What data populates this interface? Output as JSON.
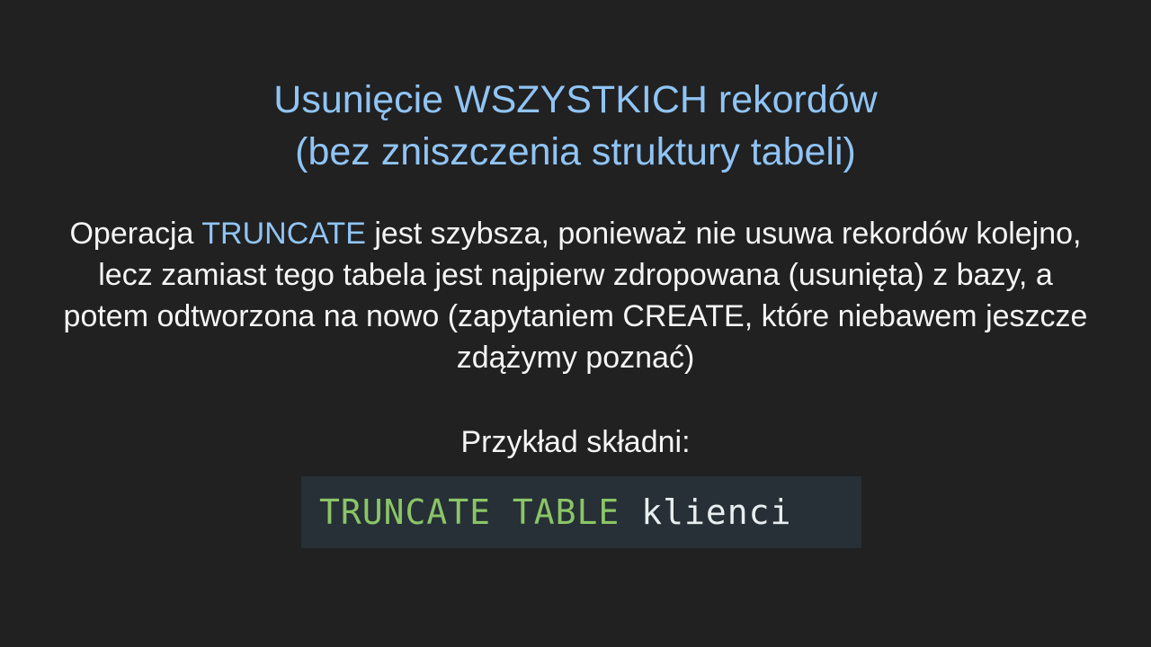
{
  "title": {
    "line1": "Usunięcie WSZYSTKICH rekordów",
    "line2": "(bez zniszczenia struktury tabeli)"
  },
  "body": {
    "prefix": "Operacja ",
    "highlight": "TRUNCATE",
    "rest": " jest szybsza, ponieważ nie usuwa rekordów kolejno, lecz zamiast tego tabela jest najpierw zdropowana (usunięta) z bazy, a potem odtworzona na nowo (zapytaniem CREATE, które niebawem jeszcze zdążymy poznać)"
  },
  "example": {
    "label": "Przykład składni:",
    "keywords": "TRUNCATE TABLE",
    "identifier": "klienci"
  },
  "colors": {
    "background": "#212121",
    "accent": "#90c4f5",
    "keyword": "#8bc567",
    "code_background": "#263036"
  }
}
